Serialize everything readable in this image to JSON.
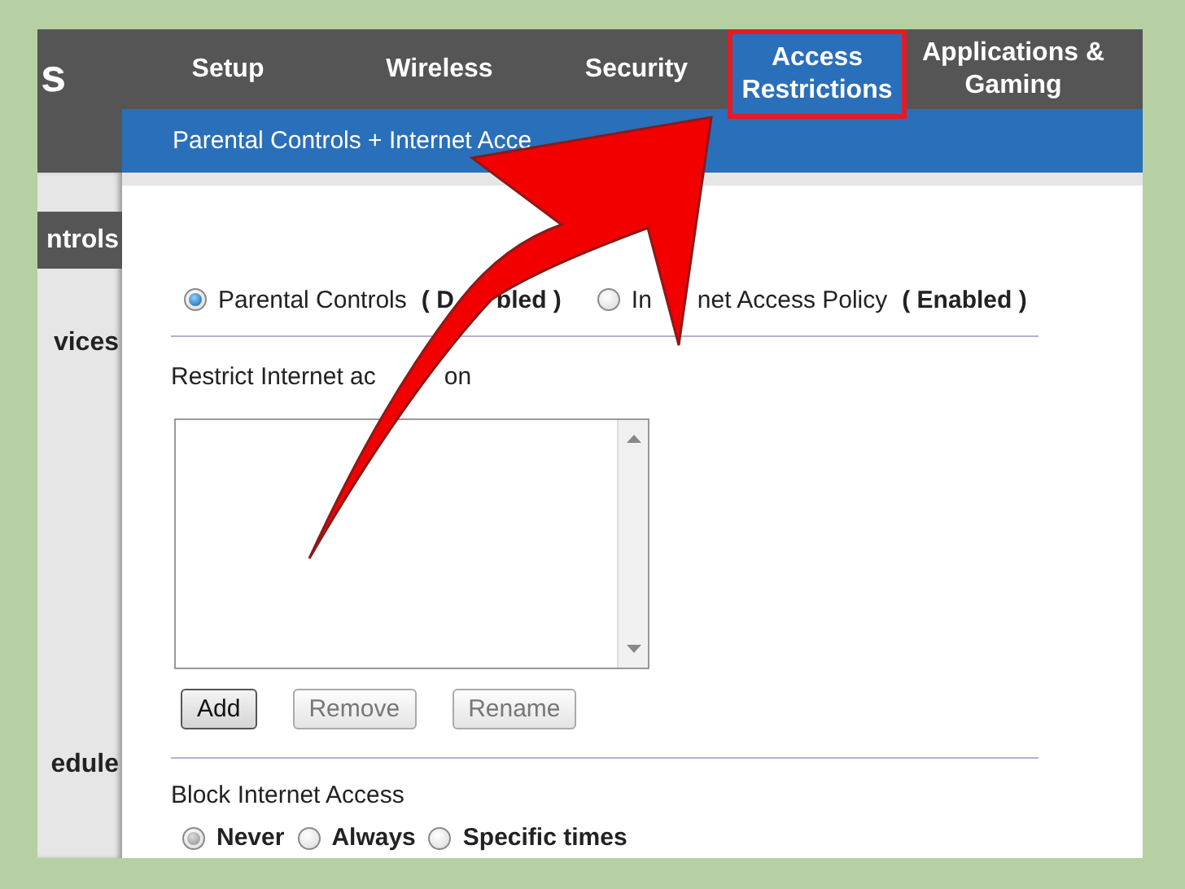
{
  "logo_fragment": "s",
  "tabs": [
    {
      "label": "Setup",
      "selected": false
    },
    {
      "label": "Wireless",
      "selected": false
    },
    {
      "label": "Security",
      "selected": false
    },
    {
      "label": "Access Restrictions",
      "selected": true
    },
    {
      "label": "Applications & Gaming",
      "selected": false
    }
  ],
  "subnav": {
    "label": "Parental Controls + Internet Acce"
  },
  "sidebar": {
    "items": [
      {
        "label": "ntrols",
        "selected": true
      },
      {
        "label": "vices",
        "selected": false
      },
      {
        "label": "edule",
        "selected": false
      }
    ]
  },
  "policy_radios": [
    {
      "selected": true,
      "label_parts": [
        "Parental Controls"
      ],
      "status_parts": [
        "( D",
        "bled )"
      ]
    },
    {
      "selected": false,
      "label_parts": [
        "In",
        "net Access Policy"
      ],
      "status_parts": [
        "( Enabled )"
      ]
    }
  ],
  "restrict_label_parts": [
    "Restrict Internet ac",
    "on"
  ],
  "list_buttons": [
    {
      "label": "Add",
      "disabled": false
    },
    {
      "label": "Remove",
      "disabled": true
    },
    {
      "label": "Rename",
      "disabled": true
    }
  ],
  "block_access": {
    "label": "Block Internet Access",
    "options": [
      {
        "label": "Never",
        "selected": true
      },
      {
        "label": "Always",
        "selected": false
      },
      {
        "label": "Specific times",
        "selected": false
      }
    ]
  },
  "annotation": {
    "kind": "arrow"
  }
}
